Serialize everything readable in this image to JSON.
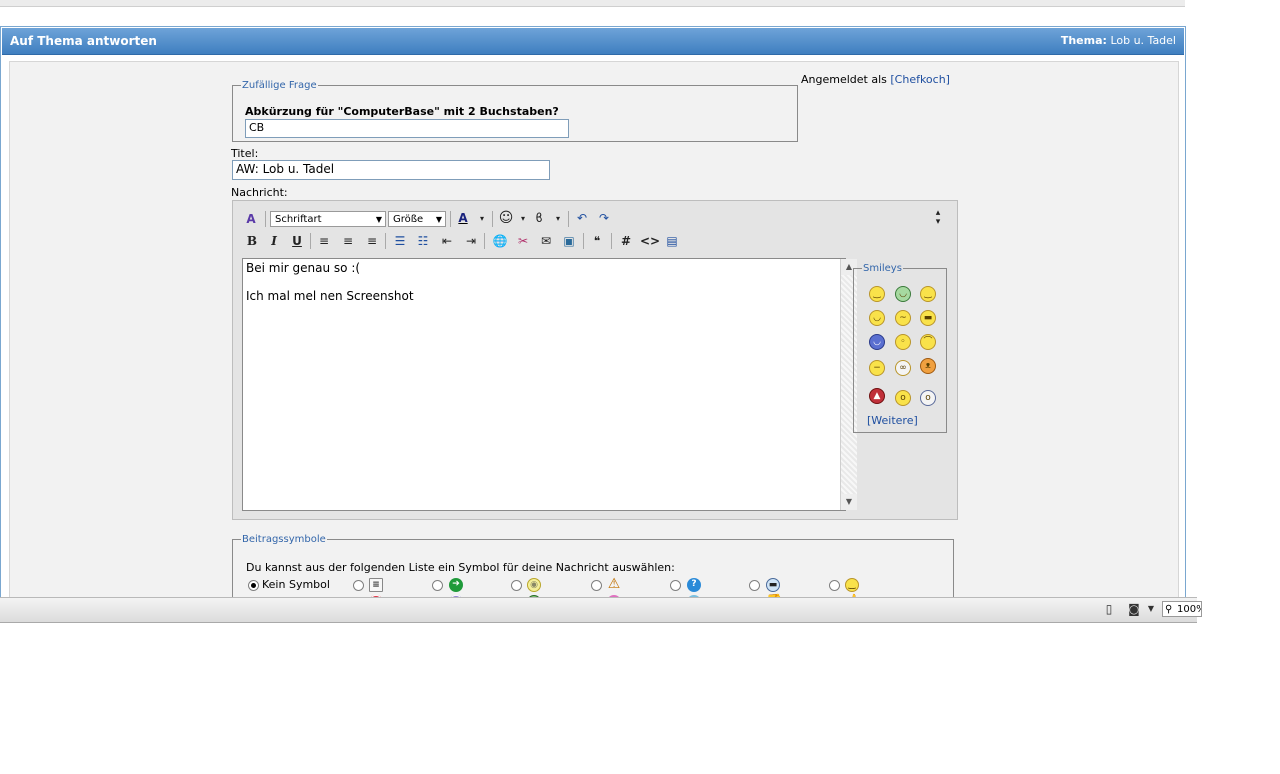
{
  "header": {
    "title": "Auf Thema antworten",
    "thema_label": "Thema:",
    "thema_value": "Lob u. Tadel"
  },
  "random_question": {
    "legend": "Zufällige Frage",
    "question": "Abkürzung für \"ComputerBase\" mit 2 Buchstaben?",
    "answer": "CB"
  },
  "login": {
    "prefix": "Angemeldet als",
    "user": "[Chefkoch]"
  },
  "title_field": {
    "label": "Titel:",
    "value": "AW: Lob u. Tadel"
  },
  "message": {
    "label": "Nachricht:",
    "font_select": "Schriftart",
    "size_select": "Größe",
    "lines": [
      "Bei mir genau so :(",
      "",
      "Ich mal mel nen Screenshot"
    ]
  },
  "smileys": {
    "legend": "Smileys",
    "more": "[Weitere]"
  },
  "post_icons": {
    "legend": "Beitragssymbole",
    "intro": "Du kannst aus der folgenden Liste ein Symbol für deine Nachricht auswählen:",
    "none_label": "Kein Symbol"
  },
  "statusbar": {
    "zoom": "100%"
  }
}
